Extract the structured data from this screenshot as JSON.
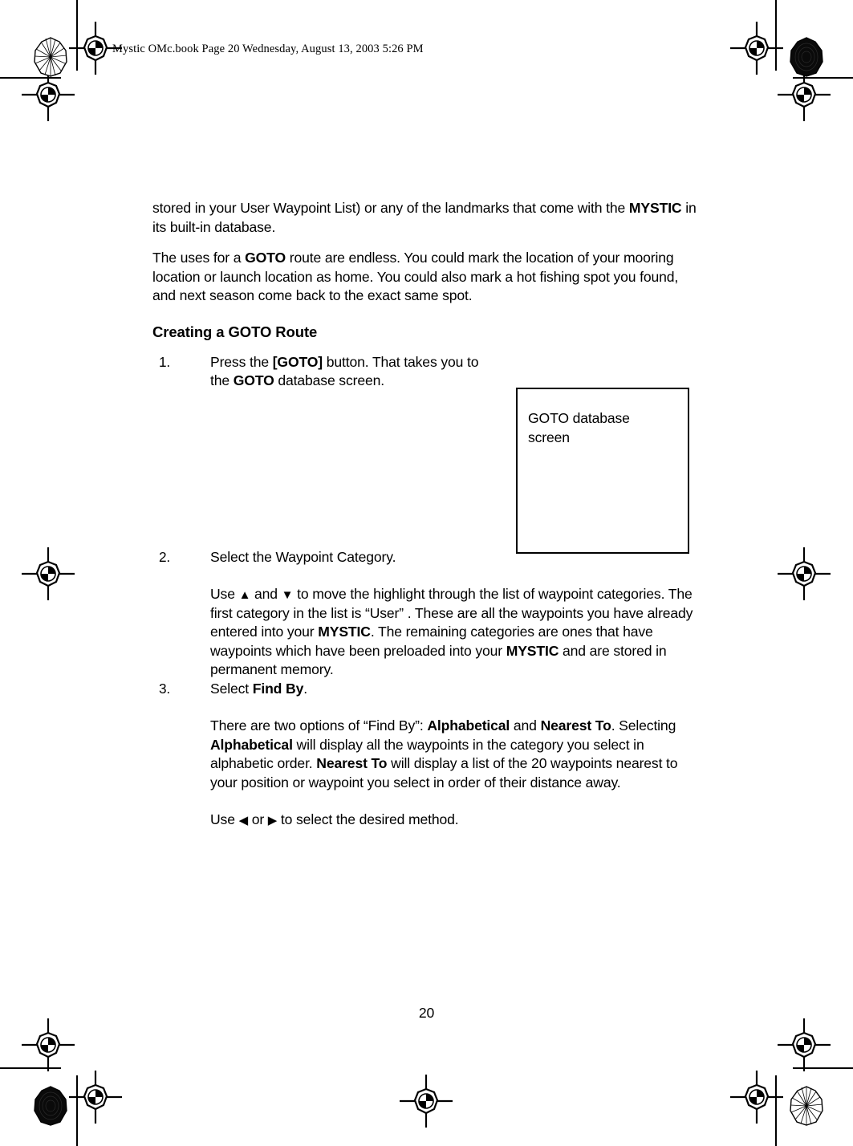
{
  "header": {
    "slug": "Mystic OMc.book  Page 20  Wednesday, August 13, 2003  5:26 PM"
  },
  "content": {
    "para1_a": "stored in your User Waypoint List) or any of the landmarks that come with the ",
    "para1_b": "MYSTIC",
    "para1_c": " in its built-in database.",
    "para2_a": "The uses for a ",
    "para2_b": "GOTO",
    "para2_c": " route are endless. You could mark the location of your mooring location or launch location as home. You could also mark a hot fishing spot you found, and next season come back to the exact same spot.",
    "heading": "Creating a GOTO Route",
    "step1": {
      "num": "1.",
      "a": "Press the ",
      "b": "[GOTO]",
      "c": " button. That takes you to the ",
      "d": "GOTO",
      "e": " database screen."
    },
    "step2": {
      "num": "2.",
      "text": "Select the Waypoint Category."
    },
    "step2_para": {
      "a": "Use ",
      "up_arrow": "▲",
      "b": " and ",
      "down_arrow": "▼",
      "c": " to move the highlight through the list of waypoint categories. The first category in the list is “User” . These are all the waypoints you have already entered into your ",
      "d": "MYSTIC",
      "e": ". The remaining categories are ones that have waypoints which have been preloaded into your ",
      "f": "MYSTIC",
      "g": " and are stored in permanent memory."
    },
    "step3": {
      "num": "3.",
      "a": "Select ",
      "b": "Find By",
      "c": "."
    },
    "step3_para": {
      "a": "There are two options of “Find By”: ",
      "b": "Alphabetical",
      "c": "  and ",
      "d": "Nearest To",
      "e": ". Selecting ",
      "f": "Alphabetical",
      "g": "  will display all the waypoints in the category you select in alphabetic order. ",
      "h": "Nearest To",
      "i": " will display a list of the 20 waypoints nearest to your position or waypoint you select in order of their distance away."
    },
    "step3_para2": {
      "a": "Use  ",
      "left_arrow": "◀",
      "b": " or ",
      "right_arrow": "▶",
      "c": "  to select the desired method."
    }
  },
  "figure": {
    "caption": "GOTO database screen"
  },
  "folio": {
    "page_number": "20"
  },
  "colors": {
    "ink": "#000000",
    "paper": "#ffffff"
  }
}
